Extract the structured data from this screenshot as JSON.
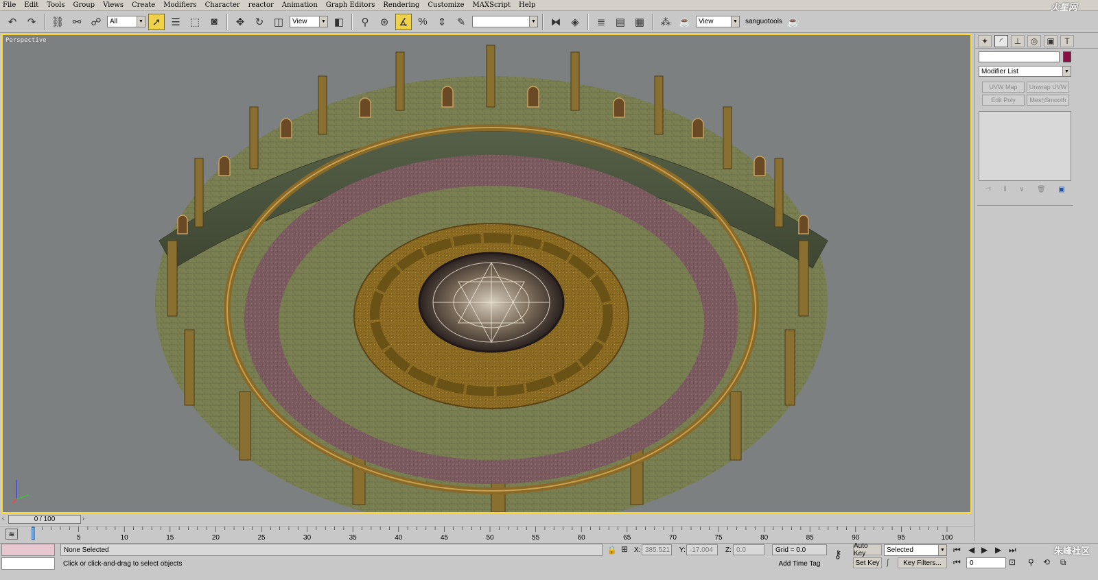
{
  "menu": [
    "File",
    "Edit",
    "Tools",
    "Group",
    "Views",
    "Create",
    "Modifiers",
    "Character",
    "reactor",
    "Animation",
    "Graph Editors",
    "Rendering",
    "Customize",
    "MAXScript",
    "Help"
  ],
  "logo_text": "火星网",
  "toolbar": {
    "selection_filter": "All",
    "reference_coord": "View",
    "named_selection": "",
    "view_dropdown": "View",
    "custom_label": "sanguotools"
  },
  "viewport": {
    "label": "Perspective",
    "accent_color": "#ffd82a",
    "background": "#7d8080"
  },
  "command_panel": {
    "name_value": "",
    "object_color": "#8b0f47",
    "modifier_list_label": "Modifier List",
    "modifier_buttons": [
      "UVW Map",
      "Unwrap UVW",
      "Edit Poly",
      "MeshSmooth"
    ]
  },
  "timeline": {
    "frame_display": "0 / 100",
    "ticks": [
      "0",
      "5",
      "10",
      "15",
      "20",
      "25",
      "30",
      "35",
      "40",
      "45",
      "50",
      "55",
      "60",
      "65",
      "70",
      "75",
      "80",
      "85",
      "90",
      "95",
      "100"
    ]
  },
  "status": {
    "selection": "None Selected",
    "prompt": "Click or click-and-drag to select objects",
    "x_label": "X:",
    "x_value": "385.521",
    "y_label": "Y:",
    "y_value": "-17.004",
    "z_label": "Z:",
    "z_value": "0.0",
    "grid": "Grid = 0.0",
    "add_time_tag": "Add Time Tag",
    "auto_key": "Auto Key",
    "set_key": "Set Key",
    "selected_dropdown": "Selected",
    "key_filters": "Key Filters...",
    "current_frame": "0",
    "watermark": "朱峰社区"
  }
}
